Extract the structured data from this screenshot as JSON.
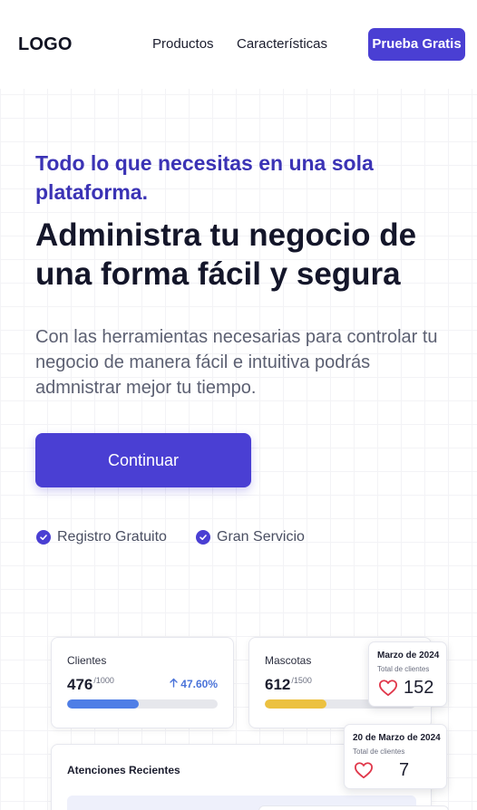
{
  "nav": {
    "logo": "LOGO",
    "links": [
      "Productos",
      "Características"
    ],
    "cta": "Prueba Gratis"
  },
  "hero": {
    "eyebrow": "Todo lo que necesitas en una sola plataforma.",
    "title": "Administra tu negocio de una forma fácil y segura",
    "description": "Con las herramientas necesarias para controlar tu negocio de manera fácil e intuitiva podrás admnistrar mejor tu tiempo.",
    "cta": "Continuar",
    "features": [
      "Registro Gratuito",
      "Gran Servicio"
    ]
  },
  "dashboard": {
    "clientes": {
      "label": "Clientes",
      "value": "476",
      "total": "/1000",
      "trend": "47.60%",
      "progress": 0.476
    },
    "mascotas": {
      "label": "Mascotas",
      "value": "612",
      "total": "/1500",
      "progress": 0.408
    },
    "recent": {
      "title": "Atenciones Recientes"
    },
    "stats": [
      {
        "date": "Marzo de 2024",
        "label": "Total de clientes",
        "value": "152"
      },
      {
        "date": "20 de Marzo de 2024",
        "label": "Total de clientes",
        "value": "7"
      }
    ]
  },
  "colors": {
    "primary": "#4a3fd3",
    "accent_blue": "#4f7ee6",
    "accent_yellow": "#ecc140",
    "heart": "#e0374a"
  }
}
